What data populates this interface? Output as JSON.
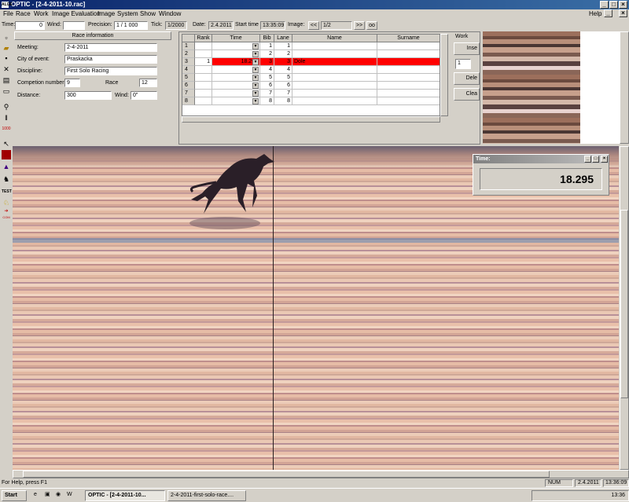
{
  "window": {
    "title": "OPTIC - [2-4-2011-10.rac]",
    "app_icon": "ALGE"
  },
  "menu": [
    "File",
    "Race",
    "Work",
    "Image Evaluation",
    "Image",
    "System",
    "Show",
    "Window"
  ],
  "menu_help": "Help",
  "toolbar": {
    "time_label": "Time:",
    "time_value": "0",
    "wind_label": "Wind:",
    "wind_value": "",
    "precision_label": "Precision:",
    "precision_value": "1 / 1 000",
    "tick_label": "Tick:",
    "tick_value": "1/2000",
    "date_label": "Date:",
    "date_value": "2.4.2011",
    "start_label": "Start time",
    "start_value": "13:35:09",
    "image_label": "Image:",
    "prev": "<<",
    "image_value": "1/2",
    "next": ">>",
    "zoom": "oo"
  },
  "race_info": {
    "header": "Race information",
    "meeting_label": "Meeting:",
    "meeting": "2-4-2011",
    "city_label": "City of event:",
    "city": "Praskacka",
    "discipline_label": "Discipline:",
    "discipline": "First Solo Racing",
    "competition_label": "Competion number:",
    "competition": "9",
    "race_label": "Race",
    "race": "12",
    "distance_label": "Distance:",
    "distance": "300",
    "wind_label": "Wind:",
    "wind": "0\""
  },
  "results": {
    "columns": [
      "Rank",
      "Time",
      "Bib",
      "Lane",
      "Name",
      "Surname"
    ],
    "rows": [
      {
        "n": "1",
        "rank": "",
        "time": "",
        "bib": "1",
        "lane": "1",
        "name": "",
        "surname": ""
      },
      {
        "n": "2",
        "rank": "",
        "time": "",
        "bib": "2",
        "lane": "2",
        "name": "",
        "surname": ""
      },
      {
        "n": "3",
        "rank": "1",
        "time": "18.295",
        "bib": "3",
        "lane": "3",
        "name": "Dole",
        "surname": ""
      },
      {
        "n": "4",
        "rank": "",
        "time": "",
        "bib": "4",
        "lane": "4",
        "name": "",
        "surname": ""
      },
      {
        "n": "5",
        "rank": "",
        "time": "",
        "bib": "5",
        "lane": "5",
        "name": "",
        "surname": ""
      },
      {
        "n": "6",
        "rank": "",
        "time": "",
        "bib": "6",
        "lane": "6",
        "name": "",
        "surname": ""
      },
      {
        "n": "7",
        "rank": "",
        "time": "",
        "bib": "7",
        "lane": "7",
        "name": "",
        "surname": ""
      },
      {
        "n": "8",
        "rank": "",
        "time": "",
        "bib": "8",
        "lane": "8",
        "name": "",
        "surname": ""
      }
    ]
  },
  "work": {
    "header": "Work",
    "insert": "Inse",
    "spinner": "1",
    "delete": "Dele",
    "clear": "Clea"
  },
  "time_window": {
    "title": "Time:",
    "value": "18.295"
  },
  "left_tools": [
    "new-icon",
    "open-icon",
    "save-icon",
    "close-icon",
    "print-icon",
    "window-icon",
    "zoom-icon",
    "bars-icon",
    "label-icon",
    "pointer-icon",
    "red-block-icon",
    "purple-block-icon",
    "runner-icon",
    "test-icon",
    "dog-icon",
    "arrow-icon"
  ],
  "left_tool_text": {
    "label": "1000",
    "test": "TEST",
    "com": "COM"
  },
  "status": {
    "help": "For Help, press F1",
    "num": "NUM",
    "date": "2.4.2011",
    "time": "13:36:09"
  },
  "taskbar": {
    "start": "Start",
    "task1": "OPTIC - [2-4-2011-10...",
    "task2": "2-4-2011-first-solo-race....",
    "clock": "13:36"
  },
  "colors": {
    "highlight_row": "#ff0000",
    "title_bar": "#0a246a"
  }
}
